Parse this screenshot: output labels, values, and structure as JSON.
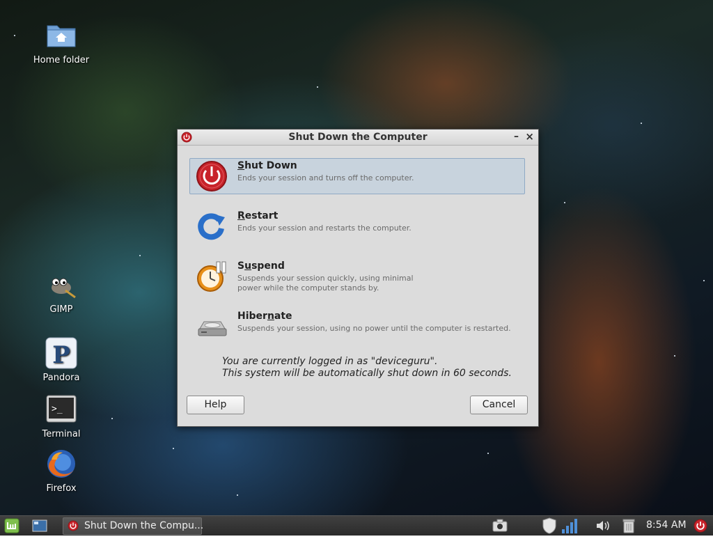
{
  "desktop": {
    "icons": [
      {
        "label": "Home folder",
        "icon": "home-folder-icon"
      },
      {
        "label": "GIMP",
        "icon": "gimp-icon"
      },
      {
        "label": "Pandora",
        "icon": "pandora-icon"
      },
      {
        "label": "Terminal",
        "icon": "terminal-icon"
      },
      {
        "label": "Firefox",
        "icon": "firefox-icon"
      }
    ]
  },
  "dialog": {
    "title": "Shut Down the Computer",
    "minimize_glyph": "–",
    "close_glyph": "×",
    "options": [
      {
        "label": "Shut Down",
        "mnemonic": "S",
        "description": "Ends your session and turns off the computer.",
        "icon": "power-icon",
        "selected": true
      },
      {
        "label": "Restart",
        "mnemonic": "R",
        "description": "Ends your session and restarts the computer.",
        "icon": "restart-icon",
        "selected": false
      },
      {
        "label": "Suspend",
        "mnemonic": "u",
        "description": "Suspends your session quickly, using minimal power while the computer stands by.",
        "icon": "suspend-icon",
        "selected": false
      },
      {
        "label": "Hibernate",
        "mnemonic": "n",
        "description": "Suspends your session, using no power until the computer is restarted.",
        "icon": "hibernate-icon",
        "selected": false
      }
    ],
    "info_line1": "You are currently logged in as \"deviceguru\".",
    "info_line2": "This system will be automatically shut down in 60 seconds.",
    "help_label": "Help",
    "cancel_label": "Cancel"
  },
  "taskbar": {
    "task_label": "Shut Down the Compu...",
    "clock": "8:54 AM"
  },
  "colors": {
    "selection_bg": "#c8d3dd",
    "power_red": "#c8232a",
    "restart_blue": "#2a6fc9",
    "suspend_orange": "#e8901a"
  }
}
